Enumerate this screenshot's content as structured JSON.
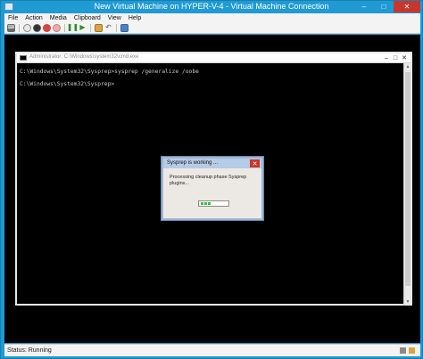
{
  "window": {
    "title": "New Virtual Machine on HYPER-V-4 - Virtual Machine Connection",
    "minimize": "–",
    "maximize": "□",
    "close": "✕"
  },
  "menu": [
    "File",
    "Action",
    "Media",
    "Clipboard",
    "View",
    "Help"
  ],
  "toolbar": {
    "icons": [
      "ctrl-alt-del-icon",
      "start-icon",
      "turn-off-icon",
      "shutdown-icon",
      "save-icon",
      "pause-icon",
      "reset-icon",
      "checkpoint-icon",
      "revert-icon",
      "enhanced-session-icon"
    ]
  },
  "cmd": {
    "title": "Administrator: C:\\Windows\\system32\\cmd.exe",
    "lines": [
      "C:\\Windows\\System32\\Sysprep>sysprep /generalize /oobe",
      "C:\\Windows\\System32\\Sysprep>"
    ],
    "minimize": "–",
    "maximize": "□",
    "close": "✕"
  },
  "sysprep_dialog": {
    "title": "Sysprep is working ...",
    "message": "Processing cleanup phase Sysprep plugins...",
    "close": "✕"
  },
  "status": {
    "text": "Status: Running"
  },
  "colors": {
    "title_bar": "#1f9ad3",
    "close_red": "#c7372c",
    "progress_green": "#2fc43a"
  }
}
